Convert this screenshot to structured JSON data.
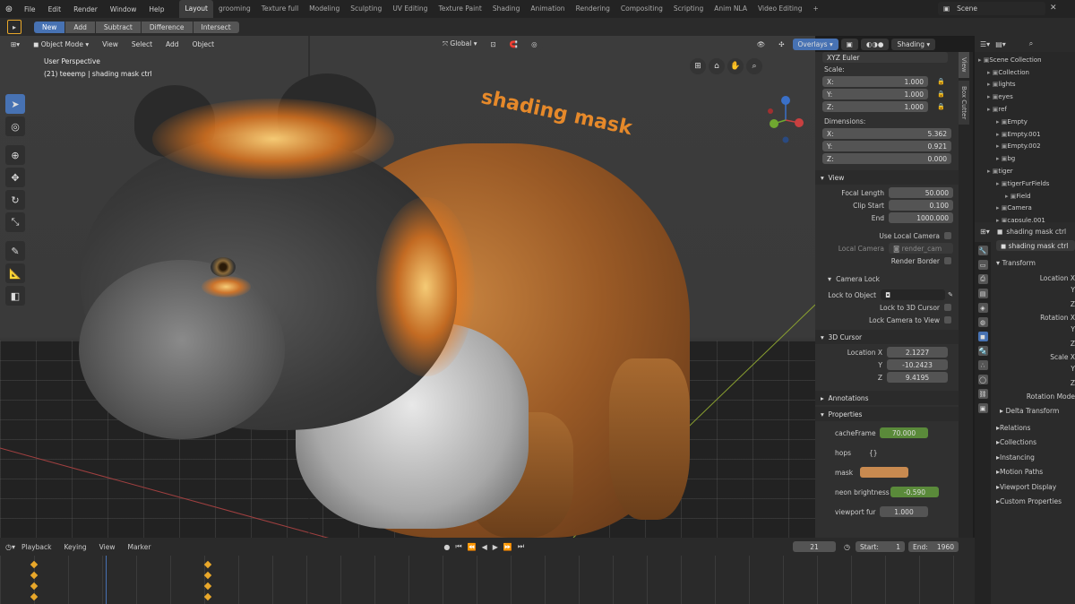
{
  "topbar": {
    "menus": [
      "File",
      "Edit",
      "Render",
      "Window",
      "Help"
    ],
    "workspaces": [
      "Layout",
      "grooming",
      "Texture full",
      "Modeling",
      "Sculpting",
      "UV Editing",
      "Texture Paint",
      "Shading",
      "Animation",
      "Rendering",
      "Compositing",
      "Scripting",
      "Anim NLA",
      "Video Editing"
    ],
    "active_workspace": "Layout",
    "add_tab": "+",
    "scene": "Scene"
  },
  "tool_options": {
    "modes": [
      "New",
      "Add",
      "Subtract",
      "Difference",
      "Intersect"
    ],
    "active_mode": "New"
  },
  "viewport_header": {
    "mode": "Object Mode",
    "menus": [
      "View",
      "Select",
      "Add",
      "Object"
    ],
    "orientation": "Global",
    "overlays": "Overlays",
    "shading": "Shading"
  },
  "viewport": {
    "perspective": "User Perspective",
    "object_info": "(21) teeemp | shading mask ctrl",
    "text_object": "shading mask"
  },
  "npanel": {
    "rotation_mode": "XYZ Euler",
    "scale_label": "Scale:",
    "scale": [
      {
        "axis": "X:",
        "value": "1.000"
      },
      {
        "axis": "Y:",
        "value": "1.000"
      },
      {
        "axis": "Z:",
        "value": "1.000"
      }
    ],
    "dimensions_label": "Dimensions:",
    "dimensions": [
      {
        "axis": "X:",
        "value": "5.362"
      },
      {
        "axis": "Y:",
        "value": "0.921"
      },
      {
        "axis": "Z:",
        "value": "0.000"
      }
    ],
    "view": {
      "title": "View",
      "focal_length_label": "Focal Length",
      "focal_length": "50.000",
      "clip_start_label": "Clip Start",
      "clip_start": "0.100",
      "end_label": "End",
      "end": "1000.000",
      "use_local_camera": "Use Local Camera",
      "local_camera_label": "Local Camera",
      "local_camera": "render_cam",
      "render_border": "Render Border"
    },
    "camera_lock": {
      "title": "Camera Lock",
      "lock_to_object": "Lock to Object",
      "lock_to_3d_cursor": "Lock to 3D Cursor",
      "lock_camera_to_view": "Lock Camera to View"
    },
    "cursor": {
      "title": "3D Cursor",
      "location_x_label": "Location X",
      "x": "2.1227",
      "y_label": "Y",
      "y": "-10.2423",
      "z_label": "Z",
      "z": "9.4195"
    },
    "annotations": "Annotations",
    "properties": {
      "title": "Properties",
      "items": [
        {
          "label": "cacheFrame",
          "value": "70.000"
        },
        {
          "label": "hops",
          "value": "{}"
        },
        {
          "label": "mask",
          "value": ""
        },
        {
          "label": "neon brightness",
          "value": "-0.590"
        },
        {
          "label": "viewport fur",
          "value": "1.000"
        }
      ]
    },
    "tabs": [
      "View",
      "Box Cutter"
    ]
  },
  "outliner": {
    "items": [
      {
        "label": "Scene Collection",
        "indent": 0
      },
      {
        "label": "Collection",
        "indent": 1
      },
      {
        "label": "lights",
        "indent": 1
      },
      {
        "label": "eyes",
        "indent": 1
      },
      {
        "label": "ref",
        "indent": 1
      },
      {
        "label": "Empty",
        "indent": 2
      },
      {
        "label": "Empty.001",
        "indent": 2
      },
      {
        "label": "Empty.002",
        "indent": 2
      },
      {
        "label": "bg",
        "indent": 2
      },
      {
        "label": "tiger",
        "indent": 1
      },
      {
        "label": "tigerFurFields",
        "indent": 2
      },
      {
        "label": "Field",
        "indent": 3
      },
      {
        "label": "Camera",
        "indent": 2
      },
      {
        "label": "capsule.001",
        "indent": 2
      }
    ]
  },
  "properties_editor": {
    "object_name": "shading mask ctrl",
    "object_field": "shading mask ctrl",
    "transform": "Transform",
    "fields": [
      "Location X",
      "Y",
      "Z",
      "Rotation X",
      "Y",
      "Z",
      "Scale X",
      "Y",
      "Z",
      "Rotation Mode"
    ],
    "delta_transform": "Delta Transform",
    "sections": [
      "Relations",
      "Collections",
      "Instancing",
      "Motion Paths",
      "Viewport Display",
      "Custom Properties"
    ]
  },
  "timeline": {
    "menus": [
      "Playback",
      "Keying",
      "View",
      "Marker"
    ],
    "current_frame": "21",
    "start_label": "Start:",
    "start": "1",
    "end_label": "End:",
    "end": "1960"
  },
  "colors": {
    "accent": "#4772b3",
    "neon": "#e6892a",
    "green_field": "#5a8a3a",
    "keyframe": "#e8a72a"
  }
}
